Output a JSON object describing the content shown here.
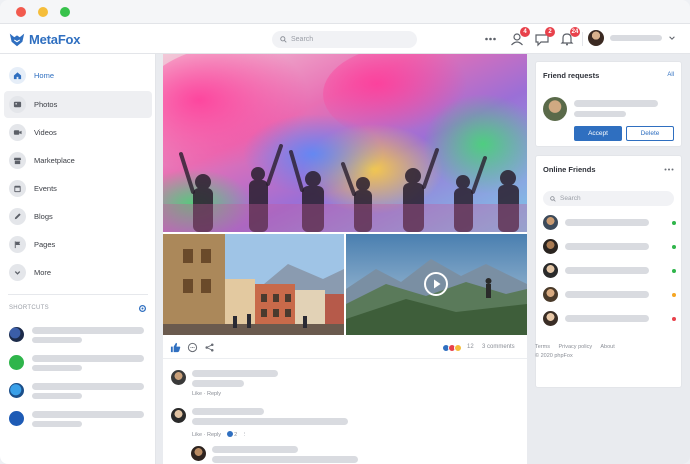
{
  "app": {
    "name": "MetaFox"
  },
  "topbar": {
    "search_placeholder": "Search",
    "notifications": [
      {
        "icon": "friend-request-icon",
        "count": "4"
      },
      {
        "icon": "messages-icon",
        "count": "2"
      },
      {
        "icon": "notification-bell-icon",
        "count": "24"
      }
    ],
    "menu_icon": "apps-dots-icon"
  },
  "sidebar": {
    "items": [
      {
        "label": "Home",
        "icon": "home-icon",
        "active": true
      },
      {
        "label": "Photos",
        "icon": "photo-icon"
      },
      {
        "label": "Videos",
        "icon": "video-icon"
      },
      {
        "label": "Marketplace",
        "icon": "shop-icon"
      },
      {
        "label": "Events",
        "icon": "calendar-icon"
      },
      {
        "label": "Blogs",
        "icon": "pencil-icon"
      },
      {
        "label": "Pages",
        "icon": "flag-icon"
      },
      {
        "label": "More",
        "icon": "chevron-down-icon"
      }
    ],
    "shortcuts_title": "SHORTCUTS"
  },
  "feed": {
    "reaction_count": "12",
    "comments_label": "3 comments",
    "comments": [
      {
        "meta": "Like · Reply"
      },
      {
        "meta": "Like · Reply",
        "reaction_count": "2"
      }
    ]
  },
  "friend_requests": {
    "title": "Friend requests",
    "link": "All",
    "accept_label": "Accept",
    "delete_label": "Delete"
  },
  "online_friends": {
    "title": "Online Friends",
    "search_placeholder": "Search",
    "statuses": [
      "online",
      "online",
      "online",
      "away",
      "busy"
    ]
  },
  "footer": {
    "links": [
      "Terms",
      "Privacy policy",
      "About"
    ],
    "copyright": "© 2020 phpFox"
  },
  "colors": {
    "brand": "#2f6fc0",
    "badge": "#e8414b",
    "online": "#2fb54b",
    "away": "#f5a623",
    "busy": "#e8414b"
  }
}
